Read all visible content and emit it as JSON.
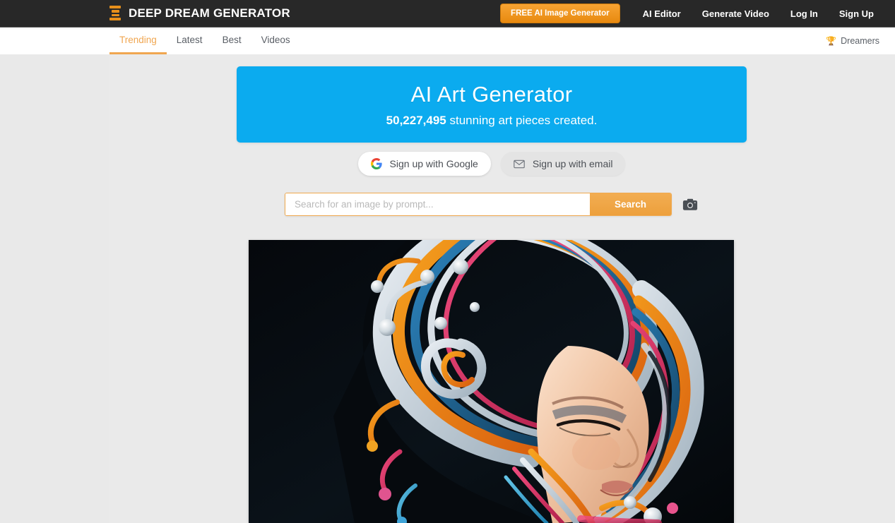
{
  "header": {
    "brand": "DEEP DREAM GENERATOR",
    "logo_icon": "hourglass-logo-icon",
    "cta_label": "FREE AI Image Generator",
    "links": [
      {
        "label": "AI Editor",
        "name": "ai-editor"
      },
      {
        "label": "Generate Video",
        "name": "generate-video"
      },
      {
        "label": "Log In",
        "name": "log-in"
      },
      {
        "label": "Sign Up",
        "name": "sign-up"
      }
    ],
    "accent_color": "#e8901b",
    "background_color": "#282828"
  },
  "subnav": {
    "tabs": [
      {
        "label": "Trending",
        "active": true
      },
      {
        "label": "Latest",
        "active": false
      },
      {
        "label": "Best",
        "active": false
      },
      {
        "label": "Videos",
        "active": false
      }
    ],
    "dreamers_label": "Dreamers",
    "dreamers_icon": "trophy-icon",
    "active_color": "#f0a650"
  },
  "hero": {
    "title": "AI Art Generator",
    "count": "50,227,495",
    "subtitle_suffix": " stunning art pieces created.",
    "background_color": "#0babef"
  },
  "signup": {
    "google_label": "Sign up with Google",
    "google_icon": "google-g-icon",
    "email_label": "Sign up with email",
    "email_icon": "envelope-icon"
  },
  "search": {
    "placeholder": "Search for an image by prompt...",
    "value": "",
    "button_label": "Search",
    "camera_icon": "camera-icon",
    "accent_color": "#f0a94e"
  },
  "artwork": {
    "alt": "AI generated portrait of a woman with flowing multicolored swirling hair",
    "background_color": "#000000"
  }
}
